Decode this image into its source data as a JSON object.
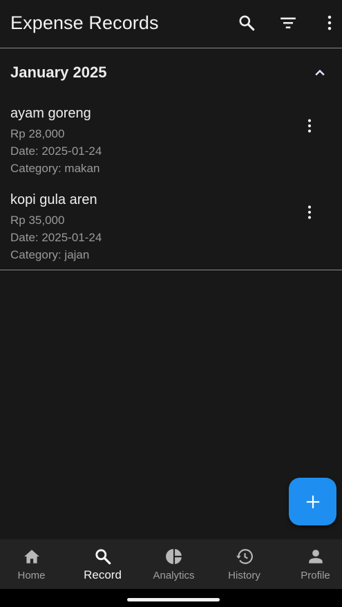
{
  "appbar": {
    "title": "Expense Records",
    "actions": [
      "search-icon",
      "filter-icon",
      "more-vert-icon"
    ]
  },
  "section": {
    "month": "January 2025",
    "expanded": true
  },
  "records": [
    {
      "name": "ayam goreng",
      "amount": "Rp 28,000",
      "date": "Date: 2025-01-24",
      "category": "Category: makan"
    },
    {
      "name": "kopi gula aren",
      "amount": "Rp 35,000",
      "date": "Date: 2025-01-24",
      "category": "Category: jajan"
    }
  ],
  "fab": {
    "icon": "add-icon",
    "color": "#1e8ff0"
  },
  "nav": {
    "active": "Record",
    "items": [
      {
        "label": "Home",
        "icon": "home-icon"
      },
      {
        "label": "Record",
        "icon": "search-icon"
      },
      {
        "label": "Analytics",
        "icon": "pie-chart-icon"
      },
      {
        "label": "History",
        "icon": "history-icon"
      },
      {
        "label": "Profile",
        "icon": "person-icon"
      }
    ]
  }
}
